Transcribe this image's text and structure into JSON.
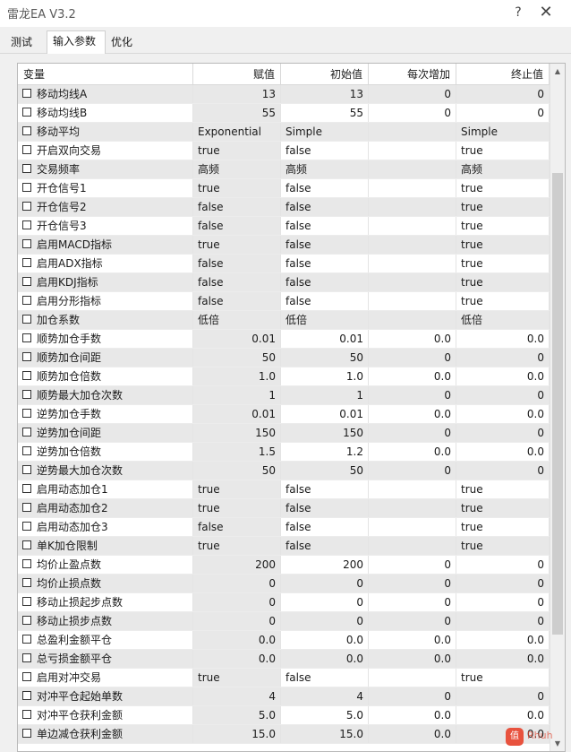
{
  "window": {
    "title": "雷龙EA V3.2",
    "help_glyph": "?",
    "close_glyph": "✕"
  },
  "tabs": [
    {
      "label": "测试",
      "active": false
    },
    {
      "label": "输入参数",
      "active": true
    },
    {
      "label": "优化",
      "active": false
    }
  ],
  "columns": [
    "变量",
    "赋值",
    "初始值",
    "每次增加",
    "终止值"
  ],
  "rows": [
    {
      "name": "移动均线A",
      "value": "13",
      "start": "13",
      "step": "0",
      "stop": "0",
      "numeric": true
    },
    {
      "name": "移动均线B",
      "value": "55",
      "start": "55",
      "step": "0",
      "stop": "0",
      "numeric": true
    },
    {
      "name": "移动平均",
      "value": "Exponential",
      "start": "Simple",
      "step": "",
      "stop": "Simple",
      "numeric": false
    },
    {
      "name": "开启双向交易",
      "value": "true",
      "start": "false",
      "step": "",
      "stop": "true",
      "numeric": false
    },
    {
      "name": "交易频率",
      "value": "高频",
      "start": "高频",
      "step": "",
      "stop": "高频",
      "numeric": false
    },
    {
      "name": "开仓信号1",
      "value": "true",
      "start": "false",
      "step": "",
      "stop": "true",
      "numeric": false
    },
    {
      "name": "开仓信号2",
      "value": "false",
      "start": "false",
      "step": "",
      "stop": "true",
      "numeric": false
    },
    {
      "name": "开仓信号3",
      "value": "false",
      "start": "false",
      "step": "",
      "stop": "true",
      "numeric": false
    },
    {
      "name": "启用MACD指标",
      "value": "true",
      "start": "false",
      "step": "",
      "stop": "true",
      "numeric": false
    },
    {
      "name": "启用ADX指标",
      "value": "false",
      "start": "false",
      "step": "",
      "stop": "true",
      "numeric": false
    },
    {
      "name": "启用KDJ指标",
      "value": "false",
      "start": "false",
      "step": "",
      "stop": "true",
      "numeric": false
    },
    {
      "name": "启用分形指标",
      "value": "false",
      "start": "false",
      "step": "",
      "stop": "true",
      "numeric": false
    },
    {
      "name": "加仓系数",
      "value": "低倍",
      "start": "低倍",
      "step": "",
      "stop": "低倍",
      "numeric": false
    },
    {
      "name": "顺势加仓手数",
      "value": "0.01",
      "start": "0.01",
      "step": "0.0",
      "stop": "0.0",
      "numeric": true
    },
    {
      "name": "顺势加仓间距",
      "value": "50",
      "start": "50",
      "step": "0",
      "stop": "0",
      "numeric": true
    },
    {
      "name": "顺势加仓倍数",
      "value": "1.0",
      "start": "1.0",
      "step": "0.0",
      "stop": "0.0",
      "numeric": true
    },
    {
      "name": "顺势最大加仓次数",
      "value": "1",
      "start": "1",
      "step": "0",
      "stop": "0",
      "numeric": true
    },
    {
      "name": "逆势加仓手数",
      "value": "0.01",
      "start": "0.01",
      "step": "0.0",
      "stop": "0.0",
      "numeric": true
    },
    {
      "name": "逆势加仓间距",
      "value": "150",
      "start": "150",
      "step": "0",
      "stop": "0",
      "numeric": true
    },
    {
      "name": "逆势加仓倍数",
      "value": "1.5",
      "start": "1.2",
      "step": "0.0",
      "stop": "0.0",
      "numeric": true
    },
    {
      "name": "逆势最大加仓次数",
      "value": "50",
      "start": "50",
      "step": "0",
      "stop": "0",
      "numeric": true
    },
    {
      "name": "启用动态加仓1",
      "value": "true",
      "start": "false",
      "step": "",
      "stop": "true",
      "numeric": false
    },
    {
      "name": "启用动态加仓2",
      "value": "true",
      "start": "false",
      "step": "",
      "stop": "true",
      "numeric": false
    },
    {
      "name": "启用动态加仓3",
      "value": "false",
      "start": "false",
      "step": "",
      "stop": "true",
      "numeric": false
    },
    {
      "name": "单K加仓限制",
      "value": "true",
      "start": "false",
      "step": "",
      "stop": "true",
      "numeric": false
    },
    {
      "name": "均价止盈点数",
      "value": "200",
      "start": "200",
      "step": "0",
      "stop": "0",
      "numeric": true
    },
    {
      "name": "均价止损点数",
      "value": "0",
      "start": "0",
      "step": "0",
      "stop": "0",
      "numeric": true
    },
    {
      "name": "移动止损起步点数",
      "value": "0",
      "start": "0",
      "step": "0",
      "stop": "0",
      "numeric": true
    },
    {
      "name": "移动止损步点数",
      "value": "0",
      "start": "0",
      "step": "0",
      "stop": "0",
      "numeric": true
    },
    {
      "name": "总盈利金额平仓",
      "value": "0.0",
      "start": "0.0",
      "step": "0.0",
      "stop": "0.0",
      "numeric": true
    },
    {
      "name": "总亏损金额平仓",
      "value": "0.0",
      "start": "0.0",
      "step": "0.0",
      "stop": "0.0",
      "numeric": true
    },
    {
      "name": "启用对冲交易",
      "value": "true",
      "start": "false",
      "step": "",
      "stop": "true",
      "numeric": false
    },
    {
      "name": "对冲平仓起始单数",
      "value": "4",
      "start": "4",
      "step": "0",
      "stop": "0",
      "numeric": true
    },
    {
      "name": "对冲平仓获利金额",
      "value": "5.0",
      "start": "5.0",
      "step": "0.0",
      "stop": "0.0",
      "numeric": true
    },
    {
      "name": "单边减仓获利金额",
      "value": "15.0",
      "start": "15.0",
      "step": "0.0",
      "stop": "0.0",
      "numeric": true
    }
  ],
  "watermark": {
    "logo": "值",
    "text": "Rhuh"
  }
}
